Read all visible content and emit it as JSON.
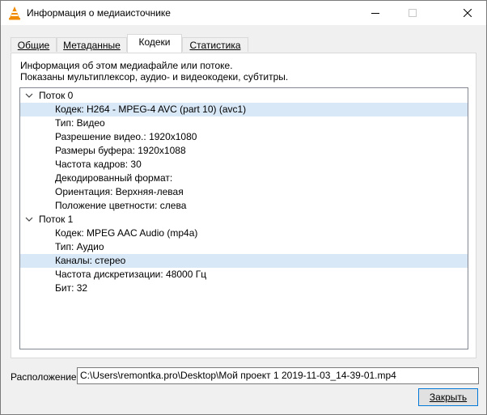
{
  "window": {
    "title": "Информация о медиаисточнике",
    "icon": "vlc-cone-icon",
    "controls": {
      "minimize": "minimize-icon",
      "maximize": "maximize-icon",
      "close": "close-icon"
    }
  },
  "tabs": [
    {
      "label": "Общие",
      "active": false
    },
    {
      "label": "Метаданные",
      "active": false
    },
    {
      "label": "Кодеки",
      "active": true
    },
    {
      "label": "Статистика",
      "active": false
    }
  ],
  "panel": {
    "info_line1": "Информация об этом медиафайле или потоке.",
    "info_line2": "Показаны мультиплексор, аудио- и видеокодеки, субтитры."
  },
  "tree": {
    "streams": [
      {
        "label": "Поток 0",
        "expanded": true,
        "items": [
          "Кодек: H264 - MPEG-4 AVC (part 10) (avc1)",
          "Тип: Видео",
          "Разрешение видео.: 1920x1080",
          "Размеры буфера: 1920x1088",
          "Частота кадров: 30",
          "Декодированный формат:",
          "Ориентация: Верхняя-левая",
          "Положение цветности: слева"
        ]
      },
      {
        "label": "Поток 1",
        "expanded": true,
        "items": [
          "Кодек: MPEG AAC Audio (mp4a)",
          "Тип: Аудио",
          "Каналы: стерео",
          "Частота дискретизации: 48000 Гц",
          "Бит: 32"
        ]
      }
    ],
    "highlighted": [
      "Кодек: H264 - MPEG-4 AVC (part 10) (avc1)",
      "Каналы: стерео"
    ]
  },
  "location": {
    "label": "Расположение:",
    "value": "C:\\Users\\remontka.pro\\Desktop\\Мой проект 1 2019-11-03_14-39-01.mp4"
  },
  "buttons": {
    "close_label": "Закрыть"
  },
  "colors": {
    "selection": "#d9e8f7",
    "button_border": "#0078d7",
    "vlc_orange": "#f08a00"
  }
}
